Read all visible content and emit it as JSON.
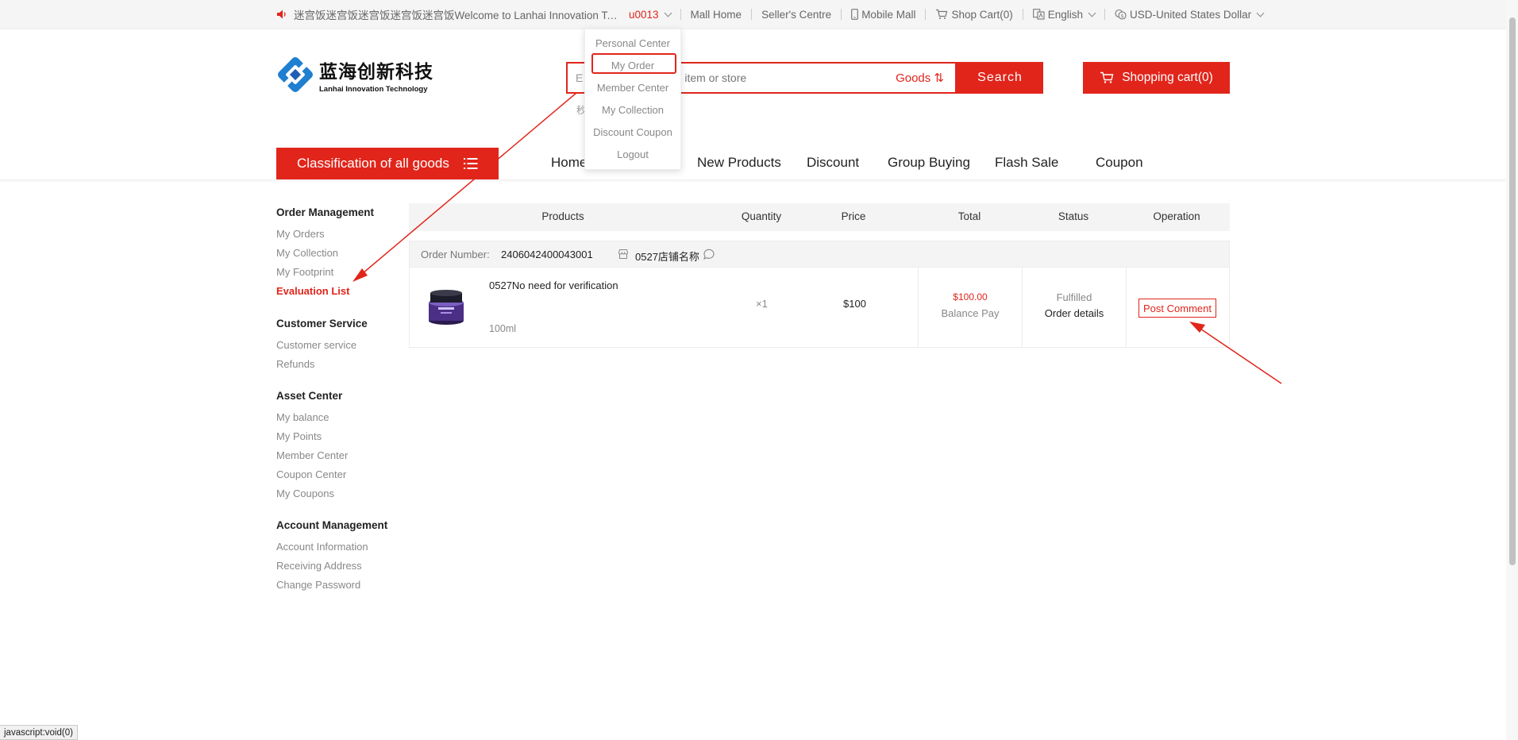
{
  "topbar": {
    "announcement": "迷宫饭迷宫饭迷宫饭迷宫饭迷宫饭Welcome to Lanhai Innovation Tec...",
    "username": "u0013",
    "links": {
      "mall_home": "Mall Home",
      "sellers_centre": "Seller's Centre",
      "mobile_mall": "Mobile Mall",
      "shop_cart": "Shop Cart(0)",
      "language": "English",
      "currency": "USD-United States Dollar"
    }
  },
  "user_menu": {
    "items": [
      "Personal Center",
      "My Order",
      "Member Center",
      "My Collection",
      "Discount Coupon",
      "Logout"
    ],
    "highlighted": "My Order"
  },
  "header": {
    "logo_cn": "蓝海创新科技",
    "logo_en": "Lanhai Innovation Technology",
    "search_prefix": "E",
    "search_placeholder": "item or store",
    "search_type": "Goods ⇅",
    "search_button": "Search",
    "cart_button": "Shopping cart(0)",
    "hot_word": "秒"
  },
  "nav": {
    "categories_button": "Classification of all goods",
    "items": [
      "Home",
      "New Products",
      "Discount",
      "Group Buying",
      "Flash Sale",
      "Coupon"
    ]
  },
  "sidebar": {
    "groups": [
      {
        "title": "Order Management",
        "items": [
          "My Orders",
          "My Collection",
          "My Footprint",
          "Evaluation List"
        ]
      },
      {
        "title": "Customer Service",
        "items": [
          "Customer service",
          "Refunds"
        ]
      },
      {
        "title": "Asset Center",
        "items": [
          "My balance",
          "My Points",
          "Member Center",
          "Coupon Center",
          "My Coupons"
        ]
      },
      {
        "title": "Account Management",
        "items": [
          "Account Information",
          "Receiving Address",
          "Change Password"
        ]
      }
    ],
    "active_item": "Evaluation List"
  },
  "orders_table": {
    "columns": [
      "Products",
      "Quantity",
      "Price",
      "Total",
      "Status",
      "Operation"
    ],
    "order": {
      "number_label": "Order Number:",
      "number": "2406042400043001",
      "store_name": "0527店铺名称",
      "product_name": "0527No need for verification",
      "product_spec": "100ml",
      "quantity": "×1",
      "price": "$100",
      "total": "$100.00",
      "payment_method": "Balance Pay",
      "status": "Fulfilled",
      "details_link": "Order details",
      "action": "Post Comment"
    }
  },
  "statusbar": "javascript:void(0)",
  "colors": {
    "accent": "#e1251b",
    "muted_text": "#888888",
    "table_header_bg": "#f4f4f4"
  },
  "icons": [
    "speaker-icon",
    "chevron-down-icon",
    "mobile-icon",
    "cart-icon",
    "language-icon",
    "currency-icon",
    "menu-icon",
    "store-icon",
    "chat-icon",
    "logo-icon"
  ]
}
